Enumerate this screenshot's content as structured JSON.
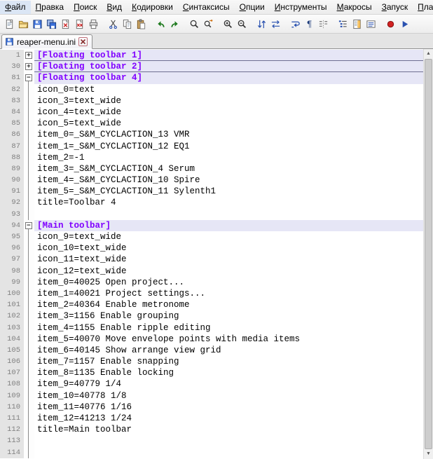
{
  "colors": {
    "section_fg": "#8000FF",
    "section_bg": "#E6E6F6"
  },
  "menu": {
    "items": [
      "Файл",
      "Правка",
      "Поиск",
      "Вид",
      "Кодировки",
      "Синтаксисы",
      "Опции",
      "Инструменты",
      "Макросы",
      "Запуск",
      "Плагины"
    ]
  },
  "toolbar": {
    "icons": [
      {
        "name": "new-file",
        "group": 1
      },
      {
        "name": "open-folder",
        "group": 1
      },
      {
        "name": "save",
        "group": 1
      },
      {
        "name": "save-all",
        "group": 1
      },
      {
        "name": "close",
        "group": 1
      },
      {
        "name": "close-all",
        "group": 1
      },
      {
        "name": "print",
        "group": 1
      },
      {
        "name": "cut",
        "group": 2
      },
      {
        "name": "copy",
        "group": 2
      },
      {
        "name": "paste",
        "group": 2
      },
      {
        "name": "undo",
        "group": 3
      },
      {
        "name": "redo",
        "group": 3
      },
      {
        "name": "find",
        "group": 4
      },
      {
        "name": "replace",
        "group": 4
      },
      {
        "name": "zoom-in",
        "group": 5
      },
      {
        "name": "zoom-out",
        "group": 5
      },
      {
        "name": "sync-vertical",
        "group": 6
      },
      {
        "name": "sync-horizontal",
        "group": 6
      },
      {
        "name": "word-wrap",
        "group": 7
      },
      {
        "name": "show-all-chars",
        "group": 7
      },
      {
        "name": "indent-guide",
        "group": 7
      },
      {
        "name": "function-list",
        "group": 8
      },
      {
        "name": "document-map",
        "group": 8
      },
      {
        "name": "document-list",
        "group": 8
      },
      {
        "name": "macro-record",
        "group": 9
      },
      {
        "name": "macro-play",
        "group": 9
      }
    ]
  },
  "tab": {
    "label": "reaper-menu.ini",
    "icon": "saved-file-icon",
    "close_icon": "close-icon"
  },
  "editor": {
    "lines": [
      {
        "num": 1,
        "text": "[Floating toolbar 1]",
        "kind": "section",
        "fold": "plus"
      },
      {
        "num": 30,
        "text": "[Floating toolbar 2]",
        "kind": "section",
        "fold": "plus"
      },
      {
        "num": 81,
        "text": "[Floating toolbar 4]",
        "kind": "section",
        "fold": "minus"
      },
      {
        "num": 82,
        "text": "icon_0=text",
        "kind": "code",
        "fold": "line"
      },
      {
        "num": 83,
        "text": "icon_3=text_wide",
        "kind": "code",
        "fold": "line"
      },
      {
        "num": 84,
        "text": "icon_4=text_wide",
        "kind": "code",
        "fold": "line"
      },
      {
        "num": 85,
        "text": "icon_5=text_wide",
        "kind": "code",
        "fold": "line"
      },
      {
        "num": 86,
        "text": "item_0=_S&M_CYCLACTION_13 VMR",
        "kind": "code",
        "fold": "line"
      },
      {
        "num": 87,
        "text": "item_1=_S&M_CYCLACTION_12 EQ1",
        "kind": "code",
        "fold": "line"
      },
      {
        "num": 88,
        "text": "item_2=-1",
        "kind": "code",
        "fold": "line"
      },
      {
        "num": 89,
        "text": "item_3=_S&M_CYCLACTION_4 Serum",
        "kind": "code",
        "fold": "line"
      },
      {
        "num": 90,
        "text": "item_4=_S&M_CYCLACTION_10 Spire",
        "kind": "code",
        "fold": "line"
      },
      {
        "num": 91,
        "text": "item_5=_S&M_CYCLACTION_11 Sylenth1",
        "kind": "code",
        "fold": "line"
      },
      {
        "num": 92,
        "text": "title=Toolbar 4",
        "kind": "code",
        "fold": "line"
      },
      {
        "num": 93,
        "text": "",
        "kind": "blank",
        "fold": "line"
      },
      {
        "num": 94,
        "text": "[Main toolbar]",
        "kind": "section",
        "fold": "minus"
      },
      {
        "num": 95,
        "text": "icon_9=text_wide",
        "kind": "code",
        "fold": "line"
      },
      {
        "num": 96,
        "text": "icon_10=text_wide",
        "kind": "code",
        "fold": "line"
      },
      {
        "num": 97,
        "text": "icon_11=text_wide",
        "kind": "code",
        "fold": "line"
      },
      {
        "num": 98,
        "text": "icon_12=text_wide",
        "kind": "code",
        "fold": "line"
      },
      {
        "num": 99,
        "text": "item_0=40025 Open project...",
        "kind": "code",
        "fold": "line"
      },
      {
        "num": 100,
        "text": "item_1=40021 Project settings...",
        "kind": "code",
        "fold": "line"
      },
      {
        "num": 101,
        "text": "item_2=40364 Enable metronome",
        "kind": "code",
        "fold": "line"
      },
      {
        "num": 102,
        "text": "item_3=1156 Enable grouping",
        "kind": "code",
        "fold": "line"
      },
      {
        "num": 103,
        "text": "item_4=1155 Enable ripple editing",
        "kind": "code",
        "fold": "line"
      },
      {
        "num": 104,
        "text": "item_5=40070 Move envelope points with media items",
        "kind": "code",
        "fold": "line"
      },
      {
        "num": 105,
        "text": "item_6=40145 Show arrange view grid",
        "kind": "code",
        "fold": "line"
      },
      {
        "num": 106,
        "text": "item_7=1157 Enable snapping",
        "kind": "code",
        "fold": "line"
      },
      {
        "num": 107,
        "text": "item_8=1135 Enable locking",
        "kind": "code",
        "fold": "line"
      },
      {
        "num": 108,
        "text": "item_9=40779 1/4",
        "kind": "code",
        "fold": "line"
      },
      {
        "num": 109,
        "text": "item_10=40778 1/8",
        "kind": "code",
        "fold": "line"
      },
      {
        "num": 110,
        "text": "item_11=40776 1/16",
        "kind": "code",
        "fold": "line"
      },
      {
        "num": 111,
        "text": "item_12=41213 1/24",
        "kind": "code",
        "fold": "line"
      },
      {
        "num": 112,
        "text": "title=Main toolbar",
        "kind": "code",
        "fold": "line"
      },
      {
        "num": 113,
        "text": "",
        "kind": "blank",
        "fold": "line"
      },
      {
        "num": 114,
        "text": "",
        "kind": "blank",
        "fold": "line"
      }
    ]
  }
}
